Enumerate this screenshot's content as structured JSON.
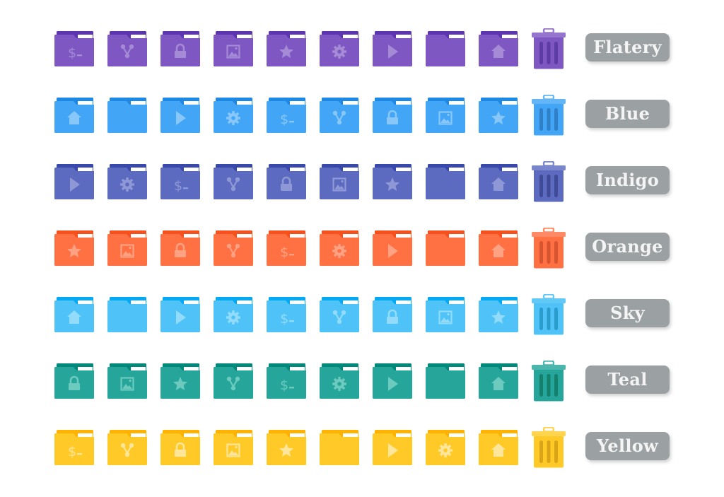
{
  "icon_columns": 9,
  "themes": [
    {
      "name": "Flatery",
      "colors": {
        "body": "#7e57c2",
        "tab": "#5e35b1",
        "glyph": "#a58ad6",
        "trash": "#7e57c2",
        "trash_lid": "#9575cd",
        "trash_stripe": "#5e3ca6"
      },
      "icons": [
        "terminal",
        "fork",
        "lock",
        "image",
        "star",
        "gear",
        "play",
        "none",
        "home"
      ]
    },
    {
      "name": "Blue",
      "colors": {
        "body": "#42a5f5",
        "tab": "#1e88e5",
        "glyph": "#88c7f9",
        "trash": "#42a5f5",
        "trash_lid": "#64b5f6",
        "trash_stripe": "#2f80c6"
      },
      "icons": [
        "home",
        "none",
        "play",
        "gear",
        "terminal",
        "fork",
        "lock",
        "image",
        "star"
      ]
    },
    {
      "name": "Indigo",
      "colors": {
        "body": "#5c6bc0",
        "tab": "#3949ab",
        "glyph": "#8e98d6",
        "trash": "#5c6bc0",
        "trash_lid": "#7986cb",
        "trash_stripe": "#3f4b96"
      },
      "icons": [
        "play",
        "gear",
        "terminal",
        "fork",
        "lock",
        "image",
        "star",
        "none",
        "home"
      ]
    },
    {
      "name": "Orange",
      "colors": {
        "body": "#ff7043",
        "tab": "#f4511e",
        "glyph": "#ffa283",
        "trash": "#ff7043",
        "trash_lid": "#ff8a65",
        "trash_stripe": "#d65530"
      },
      "icons": [
        "star",
        "image",
        "lock",
        "fork",
        "terminal",
        "gear",
        "play",
        "none",
        "home"
      ]
    },
    {
      "name": "Sky",
      "colors": {
        "body": "#4fc3f7",
        "tab": "#03a9f4",
        "glyph": "#93dbfa",
        "trash": "#4fc3f7",
        "trash_lid": "#62c9f7",
        "trash_stripe": "#2c9ccc"
      },
      "icons": [
        "home",
        "none",
        "play",
        "gear",
        "terminal",
        "fork",
        "lock",
        "image",
        "star"
      ]
    },
    {
      "name": "Teal",
      "colors": {
        "body": "#26a69a",
        "tab": "#00897b",
        "glyph": "#6ccabf",
        "trash": "#26a69a",
        "trash_lid": "#4db6ac",
        "trash_stripe": "#16806f"
      },
      "icons": [
        "lock",
        "image",
        "star",
        "fork",
        "terminal",
        "gear",
        "play",
        "none",
        "home"
      ]
    },
    {
      "name": "Yellow",
      "colors": {
        "body": "#ffca28",
        "tab": "#ffb300",
        "glyph": "#ffe69a",
        "trash": "#ffca28",
        "trash_lid": "#ffd54f",
        "trash_stripe": "#d9a418"
      },
      "icons": [
        "terminal",
        "fork",
        "lock",
        "image",
        "star",
        "none",
        "play",
        "gear",
        "home"
      ]
    }
  ]
}
